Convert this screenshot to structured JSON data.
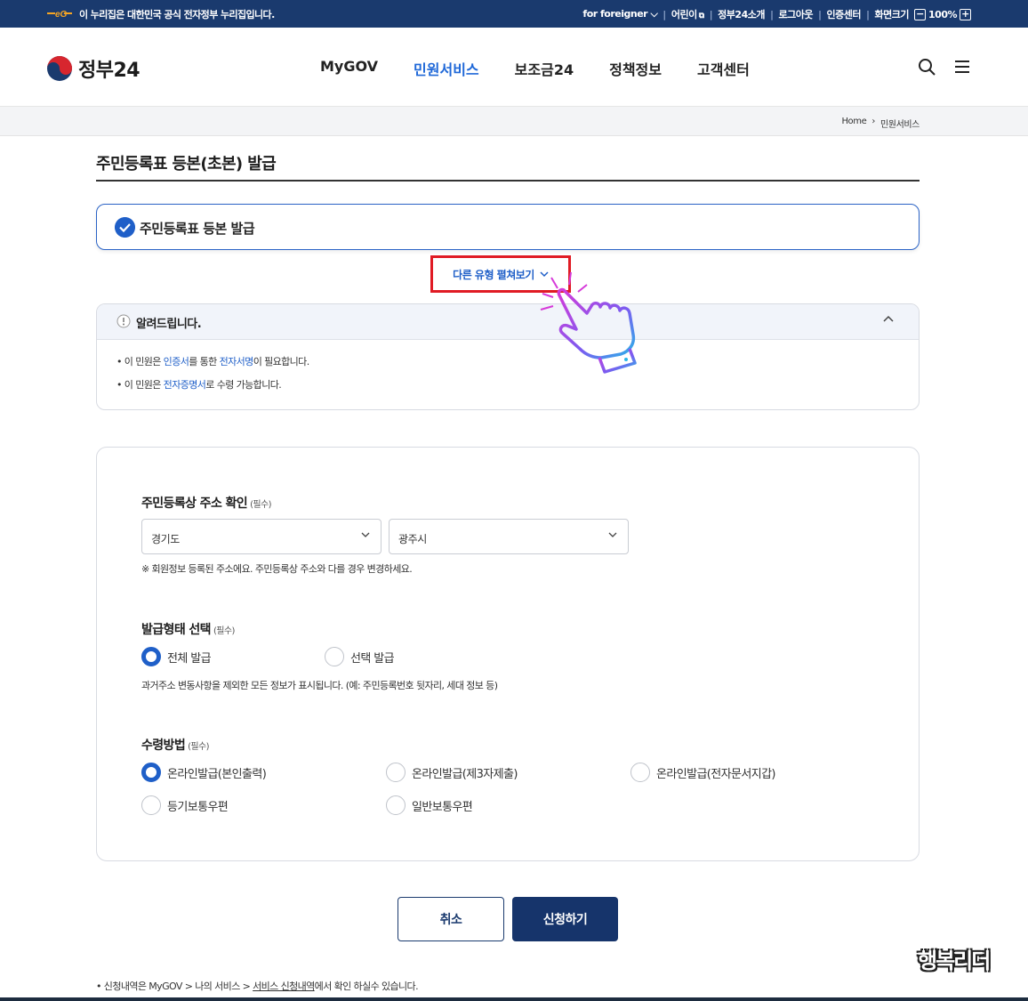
{
  "topbar": {
    "notice": "이 누리집은 대한민국 공식 전자정부 누리집입니다.",
    "foreigner": "for foreigner",
    "kids": "어린이",
    "about": "정부24소개",
    "logout": "로그아웃",
    "cert": "인증센터",
    "screen_size": "화면크기",
    "zoom": "100%",
    "zoom_out": "−",
    "zoom_in": "+"
  },
  "header": {
    "brand": "정부24",
    "nav": [
      "MyGOV",
      "민원서비스",
      "보조금24",
      "정책정보",
      "고객센터"
    ]
  },
  "breadcrumb": [
    "Home",
    "민원서비스"
  ],
  "page": {
    "title": "주민등록표 등본(초본) 발급",
    "selected_type": "주민등록표 등본 발급",
    "more_types": "다른 유형 펼쳐보기"
  },
  "notice": {
    "title": "알려드립니다.",
    "line1": {
      "a": "이 민원은 ",
      "b": "인증서",
      "c": "를 통한 ",
      "d": "전자서명",
      "e": "이 필요합니다."
    },
    "line2": {
      "a": "이 민원은 ",
      "b": "전자증명서",
      "c": "로 수령 가능합니다."
    }
  },
  "form": {
    "address": {
      "title": "주민등록상 주소 확인",
      "required": "(필수)",
      "province": "경기도",
      "city": "광주시",
      "help": "※ 회원정보 등록된 주소에요. 주민등록상 주소와 다를 경우 변경하세요."
    },
    "issue_type": {
      "title": "발급형태 선택",
      "required": "(필수)",
      "options": [
        "전체 발급",
        "선택 발급"
      ],
      "selected": "전체 발급",
      "help": "과거주소 변동사항을 제외한 모든 정보가 표시됩니다. (예: 주민등록번호 뒷자리, 세대 정보 등)"
    },
    "receive": {
      "title": "수령방법",
      "required": "(필수)",
      "options": [
        "온라인발급(본인출력)",
        "온라인발급(제3자제출)",
        "온라인발급(전자문서지갑)",
        "등기보통우편",
        "일반보통우편"
      ],
      "selected": "온라인발급(본인출력)"
    }
  },
  "buttons": {
    "cancel": "취소",
    "submit": "신청하기"
  },
  "footnote": {
    "a": "신청내역은 MyGOV > 나의 서비스 > ",
    "b": "서비스 신청내역",
    "c": "에서 확인 하실수 있습니다."
  },
  "watermark": "행복리더",
  "colors": {
    "primary": "#1f5fc8",
    "navy": "#1a3a6e",
    "highlight": "#e01b24"
  }
}
